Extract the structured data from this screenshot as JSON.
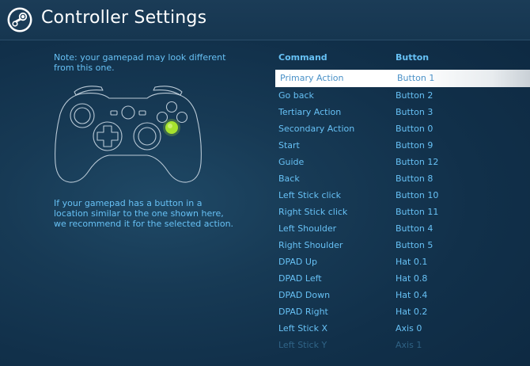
{
  "window": {
    "title": "Controller Settings",
    "logo_icon": "steam-logo-icon"
  },
  "left_panel": {
    "note": "Note: your gamepad may look different from this one.",
    "hint": "If your gamepad has a button in a location similar to the one shown here, we recommend it for the selected action.",
    "highlight_color": "#a6e22e"
  },
  "table": {
    "headers": {
      "command": "Command",
      "button": "Button"
    },
    "selected_index": 0,
    "rows": [
      {
        "command": "Primary Action",
        "button": "Button 1"
      },
      {
        "command": "Go back",
        "button": "Button 2"
      },
      {
        "command": "Tertiary Action",
        "button": "Button 3"
      },
      {
        "command": "Secondary Action",
        "button": "Button 0"
      },
      {
        "command": "Start",
        "button": "Button 9"
      },
      {
        "command": "Guide",
        "button": "Button 12"
      },
      {
        "command": "Back",
        "button": "Button 8"
      },
      {
        "command": "Left Stick click",
        "button": "Button 10"
      },
      {
        "command": "Right Stick click",
        "button": "Button 11"
      },
      {
        "command": "Left Shoulder",
        "button": "Button 4"
      },
      {
        "command": "Right Shoulder",
        "button": "Button 5"
      },
      {
        "command": "DPAD Up",
        "button": "Hat 0.1"
      },
      {
        "command": "DPAD Left",
        "button": "Hat 0.8"
      },
      {
        "command": "DPAD Down",
        "button": "Hat 0.4"
      },
      {
        "command": "DPAD Right",
        "button": "Hat 0.2"
      },
      {
        "command": "Left Stick X",
        "button": "Axis 0"
      },
      {
        "command": "Left Stick Y",
        "button": "Axis 1"
      }
    ]
  },
  "colors": {
    "accent_text": "#67c1f5",
    "selected_row_bg": "#ffffff",
    "selected_row_text": "#4a91c7"
  }
}
